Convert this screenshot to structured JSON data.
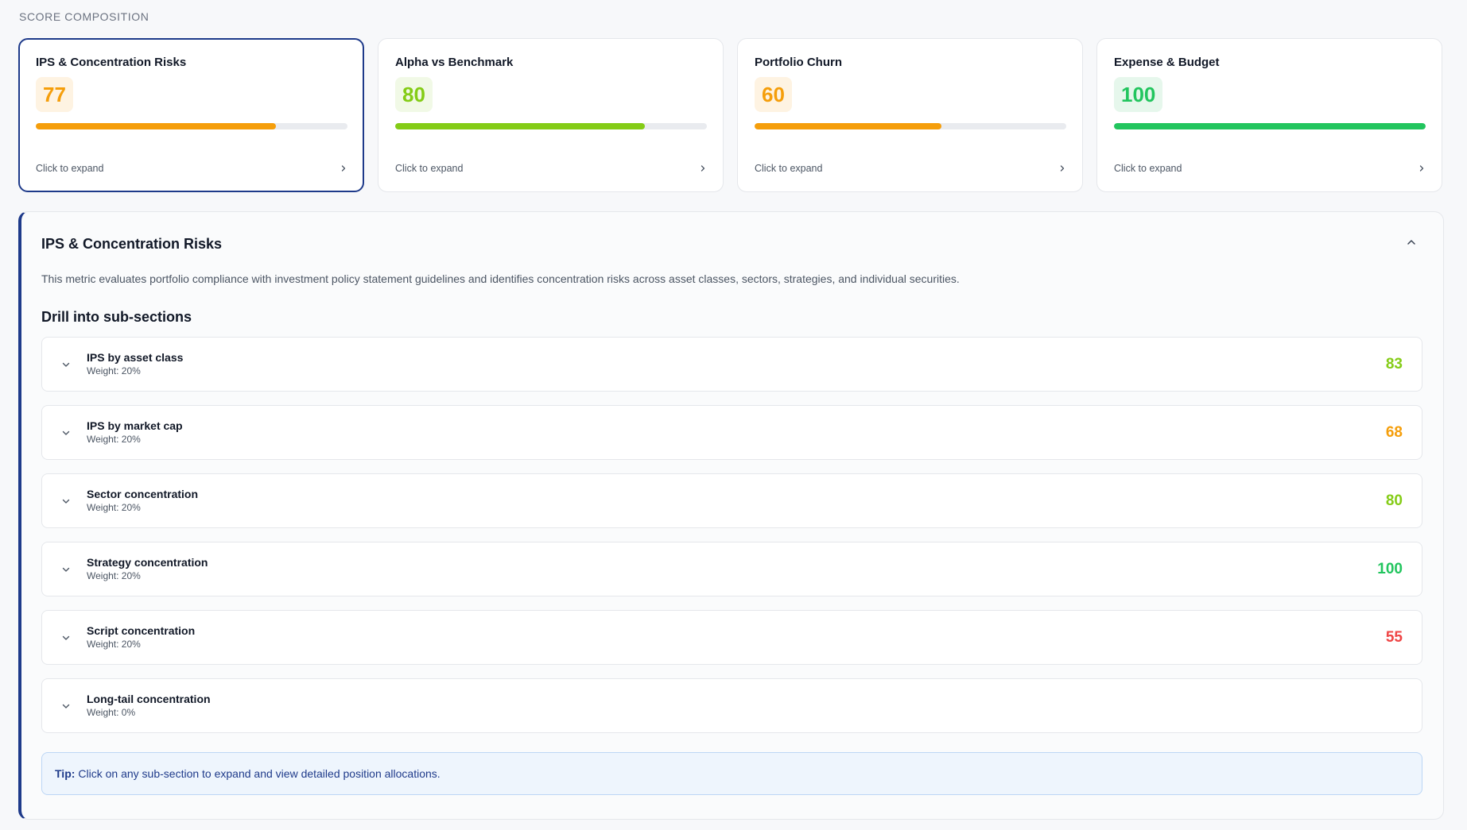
{
  "section_label": "SCORE COMPOSITION",
  "cards": [
    {
      "title": "IPS & Concentration Risks",
      "score": "77",
      "progress_pct": 77,
      "color": "#f59e0b",
      "pill_bg": "#fef3e2",
      "footer": "Click to expand",
      "active": true
    },
    {
      "title": "Alpha vs Benchmark",
      "score": "80",
      "progress_pct": 80,
      "color": "#84cc16",
      "pill_bg": "#f1f9e6",
      "footer": "Click to expand",
      "active": false
    },
    {
      "title": "Portfolio Churn",
      "score": "60",
      "progress_pct": 60,
      "color": "#f59e0b",
      "pill_bg": "#fef3e2",
      "footer": "Click to expand",
      "active": false
    },
    {
      "title": "Expense & Budget",
      "score": "100",
      "progress_pct": 100,
      "color": "#22c55e",
      "pill_bg": "#e6f7ec",
      "footer": "Click to expand",
      "active": false
    }
  ],
  "panel": {
    "title": "IPS & Concentration Risks",
    "description": "This metric evaluates portfolio compliance with investment policy statement guidelines and identifies concentration risks across asset classes, sectors, strategies, and individual securities.",
    "subheading": "Drill into sub-sections",
    "items": [
      {
        "name": "IPS by asset class",
        "weight": "Weight: 20%",
        "score": "83",
        "color": "#84cc16"
      },
      {
        "name": "IPS by market cap",
        "weight": "Weight: 20%",
        "score": "68",
        "color": "#f59e0b"
      },
      {
        "name": "Sector concentration",
        "weight": "Weight: 20%",
        "score": "80",
        "color": "#84cc16"
      },
      {
        "name": "Strategy concentration",
        "weight": "Weight: 20%",
        "score": "100",
        "color": "#22c55e"
      },
      {
        "name": "Script concentration",
        "weight": "Weight: 20%",
        "score": "55",
        "color": "#ef4444"
      },
      {
        "name": "Long-tail concentration",
        "weight": "Weight: 0%",
        "score": "",
        "color": "#111827"
      }
    ],
    "tip_label": "Tip:",
    "tip_text": "Click on any sub-section to expand and view detailed position allocations."
  },
  "icons": {
    "card_chevron": "chevron-right-icon",
    "panel_toggle": "chevron-up-icon",
    "item_chevron": "chevron-down-icon"
  }
}
